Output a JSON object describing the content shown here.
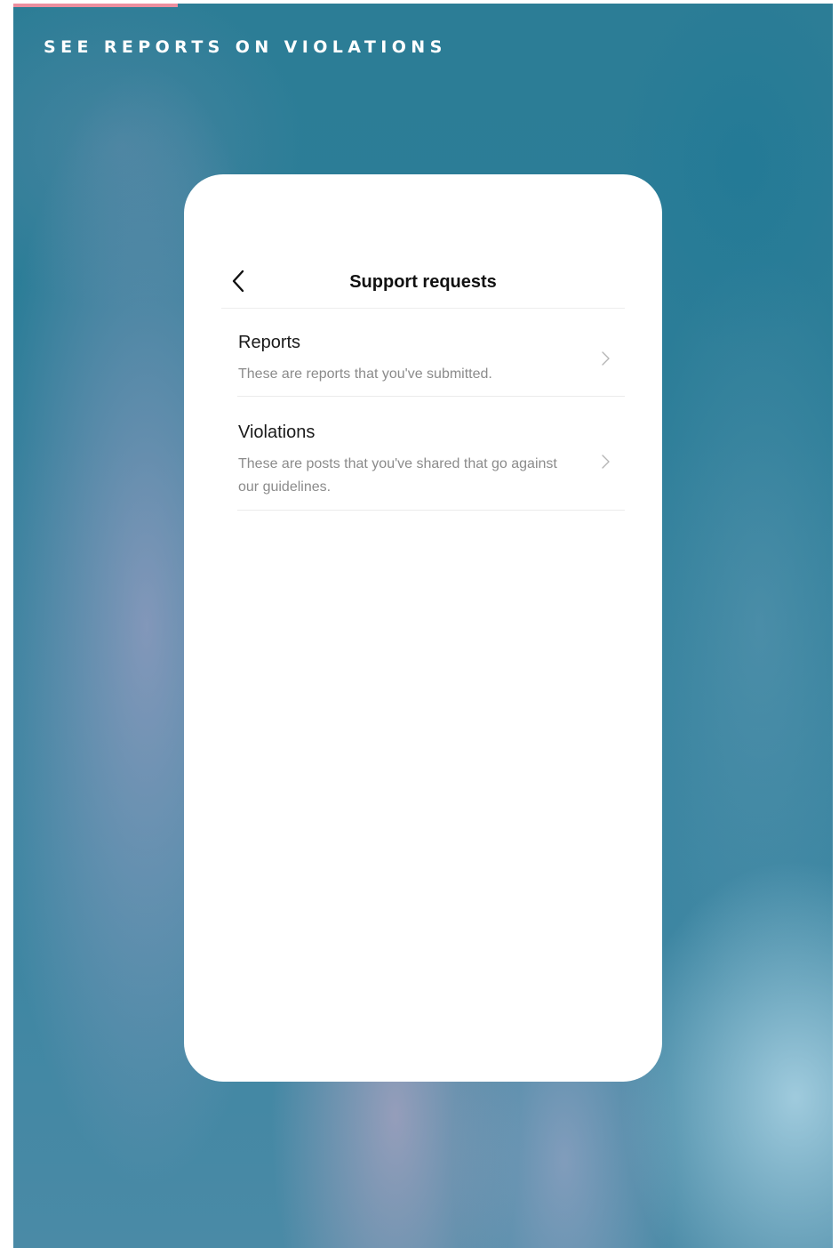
{
  "page": {
    "heading": "SEE REPORTS ON VIOLATIONS",
    "accent_color": "#ec8f9f"
  },
  "screen": {
    "nav": {
      "back_icon": "chevron-left-icon",
      "title": "Support requests"
    },
    "items": [
      {
        "title": "Reports",
        "description": "These are reports that you've submitted.",
        "icon": "chevron-right-icon"
      },
      {
        "title": "Violations",
        "description": "These are posts that you've shared that go against our guidelines.",
        "icon": "chevron-right-icon"
      }
    ]
  }
}
